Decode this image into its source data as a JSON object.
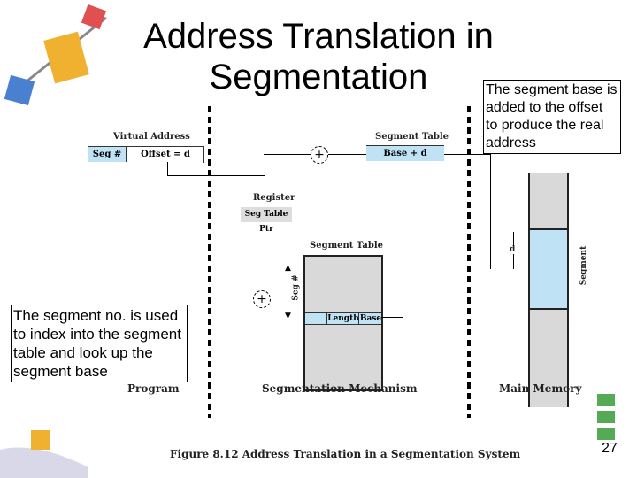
{
  "title": "Address Translation in Segmentation",
  "callout_top": "The segment base is added to the offset to produce the real address",
  "callout_left": "The segment no. is used to index into the segment table and look up the segment base",
  "diagram": {
    "virtual_address": "Virtual Address",
    "seg_num": "Seg #",
    "offset": "Offset = d",
    "segment_table_top": "Segment Table",
    "base_d": "Base + d",
    "register": "Register",
    "seg_table_ptr": "Seg Table Ptr",
    "segment_table": "Segment Table",
    "seg_axis": "Seg #",
    "length": "Length",
    "base": "Base",
    "d": "d",
    "segment": "Segment",
    "program": "Program",
    "mechanism": "Segmentation Mechanism",
    "main_memory": "Main Memory",
    "plus": "+"
  },
  "caption": "Figure 8.12   Address Translation in a Segmentation System",
  "page_number": "27",
  "colors": {
    "cell": "#bfe3f5",
    "table": "#d9d9d9"
  }
}
